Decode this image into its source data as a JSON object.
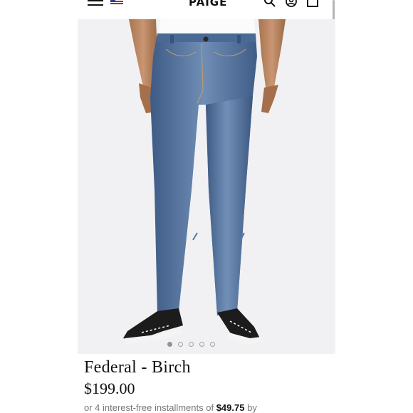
{
  "header": {
    "brand": "PAIGE",
    "icons": [
      "hamburger-menu-icon",
      "us-flag-icon",
      "search-icon",
      "account-icon",
      "cart-icon"
    ]
  },
  "product": {
    "name": "Federal - Birch",
    "price": "$199.00",
    "installments_prefix": "or 4 interest-free installments of",
    "installments_amount": "$49.75",
    "installments_suffix": "by"
  },
  "carousel": {
    "slide_count": 5,
    "active_index": 0
  },
  "colors": {
    "accent": "#111111",
    "muted_text": "#777777",
    "denim": "#4f6f9b",
    "hero_background": "#f1f1f3"
  }
}
